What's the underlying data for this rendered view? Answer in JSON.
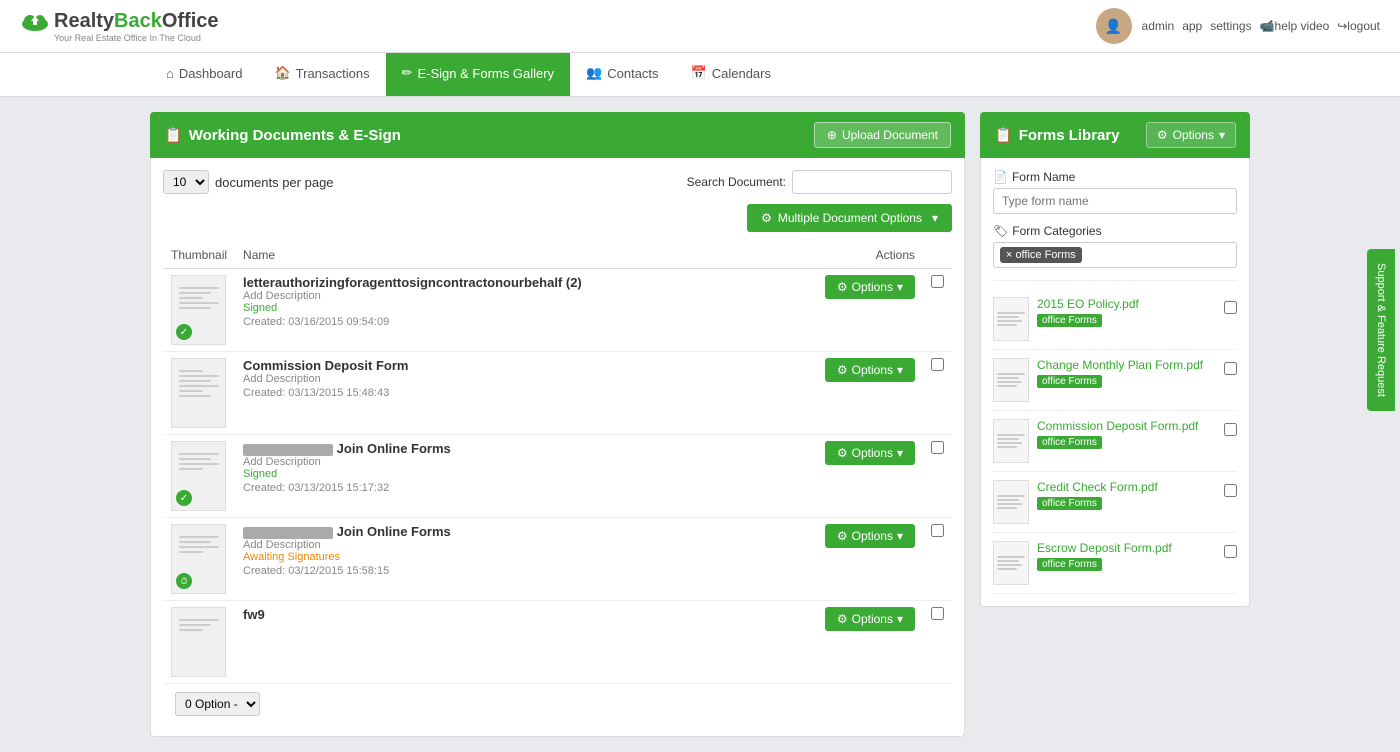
{
  "header": {
    "logo_brand": "RealtyBackOffice",
    "logo_sub": "Your Real Estate Office In The Cloud",
    "user_name": "admin",
    "nav_links": [
      "app",
      "settings",
      "help video",
      "logout"
    ]
  },
  "nav": {
    "tabs": [
      {
        "id": "dashboard",
        "label": "Dashboard",
        "icon": "home-icon",
        "active": false
      },
      {
        "id": "transactions",
        "label": "Transactions",
        "icon": "building-icon",
        "active": false
      },
      {
        "id": "esign",
        "label": "E-Sign & Forms Gallery",
        "icon": "pencil-icon",
        "active": true
      },
      {
        "id": "contacts",
        "label": "Contacts",
        "icon": "users-icon",
        "active": false
      },
      {
        "id": "calendars",
        "label": "Calendars",
        "icon": "calendar-icon",
        "active": false
      }
    ]
  },
  "working_docs": {
    "title": "Working Documents & E-Sign",
    "upload_button": "Upload Document",
    "per_page": "10",
    "per_page_label": "documents per page",
    "search_label": "Search Document:",
    "search_placeholder": "",
    "multi_options_label": "Multiple Document Options",
    "columns": {
      "thumbnail": "Thumbnail",
      "name": "Name",
      "actions": "Actions"
    },
    "pagination": {
      "option_label": "0 Option -"
    },
    "documents": [
      {
        "id": "doc1",
        "name": "letterauthorizingforagenttosigncontractonourbehalf (2)",
        "desc": "Add Description",
        "status": "Signed",
        "status_type": "signed",
        "created": "Created: 03/16/2015 09:54:09",
        "has_check": true,
        "options_label": "Options"
      },
      {
        "id": "doc2",
        "name": "Commission Deposit Form",
        "desc": "Add Description",
        "status": "",
        "status_type": "none",
        "created": "Created: 03/13/2015 15:48:43",
        "has_check": false,
        "options_label": "Options"
      },
      {
        "id": "doc3",
        "name": "Join Online Forms",
        "desc": "Add Description",
        "status": "Signed",
        "status_type": "signed",
        "created": "Created: 03/13/2015 15:17:32",
        "has_check": true,
        "redacted": true,
        "options_label": "Options"
      },
      {
        "id": "doc4",
        "name": "Join Online Forms",
        "desc": "Add Description",
        "status": "Awaiting Signatures",
        "status_type": "awaiting",
        "created": "Created: 03/12/2015 15:58:15",
        "has_check": false,
        "redacted": true,
        "has_clock": true,
        "options_label": "Options"
      },
      {
        "id": "doc5",
        "name": "fw9",
        "desc": "",
        "status": "",
        "status_type": "none",
        "created": "",
        "has_check": false,
        "options_label": "Options"
      }
    ]
  },
  "forms_library": {
    "title": "Forms Library",
    "options_button": "Options",
    "form_name_label": "Form Name",
    "form_name_placeholder": "Type form name",
    "categories_label": "Form Categories",
    "active_tag": "office Forms",
    "forms": [
      {
        "id": "f1",
        "name": "2015 EO Policy.pdf",
        "tag": "office Forms"
      },
      {
        "id": "f2",
        "name": "Change Monthly Plan Form.pdf",
        "tag": "office Forms"
      },
      {
        "id": "f3",
        "name": "Commission Deposit Form.pdf",
        "tag": "office Forms"
      },
      {
        "id": "f4",
        "name": "Credit Check Form.pdf",
        "tag": "office Forms"
      },
      {
        "id": "f5",
        "name": "Escrow Deposit Form.pdf",
        "tag": "office Forms"
      }
    ]
  },
  "support_tab": {
    "label": "Support & Feature Request"
  },
  "icons": {
    "gear": "⚙",
    "upload": "⊕",
    "pencil": "✎",
    "check": "✓",
    "clock": "○",
    "tag": "🏷",
    "doc": "📄",
    "caret": "▾",
    "x": "×"
  }
}
